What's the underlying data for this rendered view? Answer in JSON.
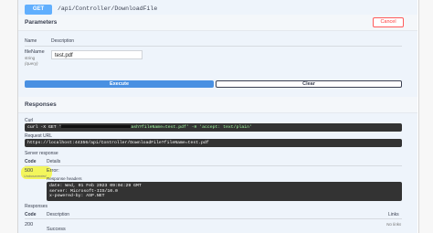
{
  "operation": {
    "method": "GET",
    "path": "/api/Controller/DownloadFile"
  },
  "parameters": {
    "title": "Parameters",
    "cancel_label": "Cancel",
    "col_name": "Name",
    "col_description": "Description",
    "param_name": "fileName",
    "param_type": "string",
    "param_location": "(query)",
    "param_value": "test.pdf"
  },
  "actions": {
    "execute_label": "Execute",
    "clear_label": "Clear"
  },
  "responses": {
    "title": "Responses",
    "curl_label": "Curl",
    "curl_prefix": "curl -X GET '",
    "curl_suffix": "ash?fileName=test.pdf' -H 'accept: text/plain'",
    "request_url_label": "Request URL",
    "request_url": "https://localhost:44356/api/Controller/DownloadFile?fileName=test.pdf",
    "server_response_label": "Server response",
    "col_code": "Code",
    "col_details": "Details",
    "server_code": "500",
    "server_code_note": "Undocumented",
    "error_text": "Error:",
    "response_headers_label": "Response headers",
    "headers": [
      "date: Wed, 01 Feb 2023 09:04:29 GMT",
      "server: Microsoft-IIS/10.0",
      "x-powered-by: ASP.NET"
    ],
    "doc_title": "Responses",
    "col_description": "Description",
    "col_links": "Links",
    "doc_code": "200",
    "doc_description": "Success",
    "no_links": "No links"
  },
  "colors": {
    "get_blue": "#61affe",
    "execute_blue": "#4990e2",
    "cancel_red": "#ff5b5b",
    "highlight": "#f3f64a"
  }
}
